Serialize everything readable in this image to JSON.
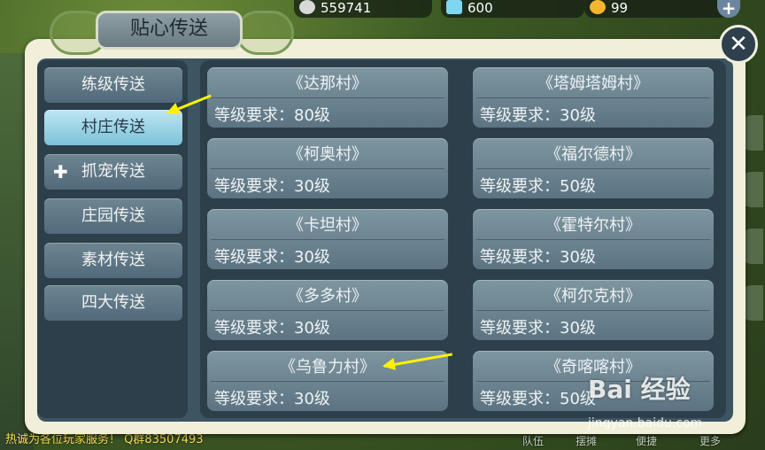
{
  "resources": [
    {
      "icon": "coin-icon",
      "value": "559741"
    },
    {
      "icon": "crystal-icon",
      "value": "600"
    },
    {
      "icon": "gold-ingot-icon",
      "value": "99"
    }
  ],
  "title": "贴心传送",
  "menu": [
    {
      "label": "练级传送"
    },
    {
      "label": "村庄传送"
    },
    {
      "label": "抓宠传送"
    },
    {
      "label": "庄园传送"
    },
    {
      "label": "素材传送"
    },
    {
      "label": "四大传送"
    }
  ],
  "villages": [
    {
      "name": "《达那村》",
      "req": "等级要求：80级"
    },
    {
      "name": "《塔姆塔姆村》",
      "req": "等级要求：30级"
    },
    {
      "name": "《柯奥村》",
      "req": "等级要求：30级"
    },
    {
      "name": "《福尔德村》",
      "req": "等级要求：50级"
    },
    {
      "name": "《卡坦村》",
      "req": "等级要求：30级"
    },
    {
      "name": "《霍特尔村》",
      "req": "等级要求：30级"
    },
    {
      "name": "《多多村》",
      "req": "等级要求：30级"
    },
    {
      "name": "《柯尔克村》",
      "req": "等级要求：30级"
    },
    {
      "name": "《乌鲁力村》",
      "req": "等级要求：30级"
    },
    {
      "name": "《奇喀喀村》",
      "req": "等级要求：50级"
    }
  ],
  "background": {
    "bottom_text": "热诚为各位玩家服务！ Q群83507493",
    "bottom_menu": [
      "队伍",
      "摆摊",
      "便捷",
      "更多"
    ]
  },
  "watermark": {
    "text": "Bai 经验",
    "sub": "jingyan.baidu.com"
  }
}
